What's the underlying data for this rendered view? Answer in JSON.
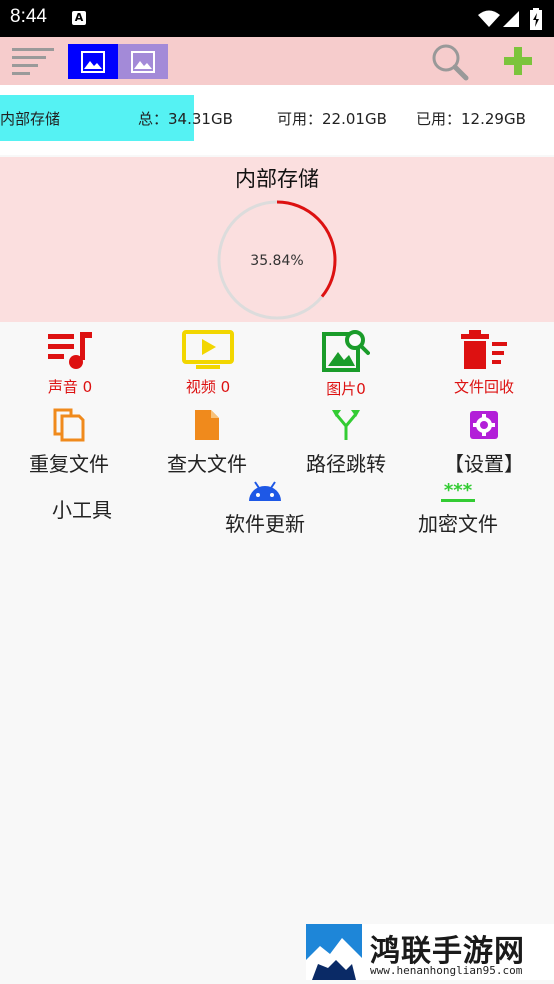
{
  "status_bar": {
    "time": "8:44",
    "notification_glyph": "A"
  },
  "toolbar": {
    "menu_icon": "sort-lines-icon",
    "view_modes": [
      "image-view-icon",
      "image-view-icon"
    ],
    "search_icon": "search-icon",
    "add_icon": "plus-icon",
    "colors": {
      "background": "#f6cccc",
      "view_active": "#0000ff",
      "view_inactive": "#a38ad8",
      "add": "#7cc43c"
    }
  },
  "storage": {
    "name": "内部存储",
    "total": "总：34.31GB",
    "available": "可用：22.01GB",
    "used": "已用：12.29GB",
    "fill_color": "#55f2f3"
  },
  "panel": {
    "title": "内部存储",
    "usage_percent_label": "35.84%",
    "usage_fraction": 0.3584,
    "ring_color": "#dd1111"
  },
  "categories": [
    {
      "label": "声音 0",
      "icon": "music-icon",
      "color": "#dd1111"
    },
    {
      "label": "视频 0",
      "icon": "video-icon",
      "color": "#f2d600"
    },
    {
      "label": "图片0",
      "icon": "image-search-icon",
      "color": "#1a9c2a"
    },
    {
      "label": "文件回收",
      "icon": "recycle-bin-icon",
      "color": "#dd1111"
    }
  ],
  "tools": [
    {
      "label": "重复文件",
      "icon": "duplicate-icon",
      "color": "#f08a1c"
    },
    {
      "label": "查大文件",
      "icon": "file-icon",
      "color": "#f08a1c"
    },
    {
      "label": "路径跳转",
      "icon": "fork-icon",
      "color": "#33cc33"
    },
    {
      "label": "【设置】",
      "icon": "gear-icon",
      "color": "#b21fd8"
    }
  ],
  "small_tools_label": "小工具",
  "extra_tools": [
    {
      "label": "软件更新",
      "icon": "android-icon",
      "color": "#1e58e6"
    },
    {
      "label": "加密文件",
      "icon": "password-icon",
      "color": "#33cc33"
    }
  ],
  "watermark": {
    "title": "鸿联手游网",
    "url": "www.henanhonglian95.com"
  }
}
